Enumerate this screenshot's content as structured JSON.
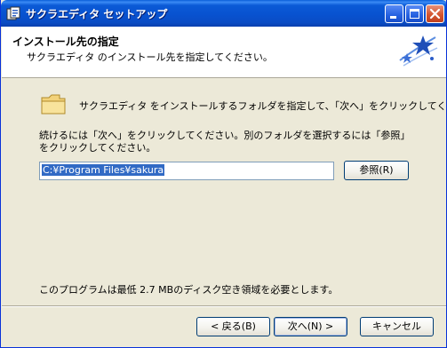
{
  "window": {
    "title": "サクラエディタ セットアップ"
  },
  "header": {
    "title": "インストール先の指定",
    "subtitle": "サクラエディタ のインストール先を指定してください。"
  },
  "main": {
    "folder_prompt": "サクラエディタ をインストールするフォルダを指定して、「次へ」をクリックしてください。",
    "instruction": "続けるには「次へ」をクリックしてください。別のフォルダを選択するには「参照」をクリックしてください。",
    "path_value": "C:¥Program Files¥sakura",
    "browse_label": "参照(R)",
    "space_required": "このプログラムは最低 2.7 MBのディスク空き領域を必要とします。"
  },
  "footer": {
    "back_label": "< 戻る(B)",
    "next_label": "次へ(N) >",
    "cancel_label": "キャンセル"
  },
  "colors": {
    "titlebar": "#0852d0",
    "selection": "#316ac5",
    "dialog_bg": "#ece9d8"
  }
}
